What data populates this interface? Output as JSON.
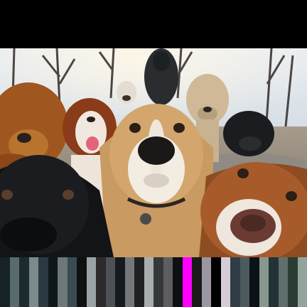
{
  "image": {
    "subject": "group-of-dogs-selfie",
    "colors": {
      "letterbox": "#000000",
      "sky": "#c9d7e6",
      "ground": "#9a8f7f",
      "trees": "#3a3230"
    }
  },
  "strip_colors": [
    "#152227",
    "#5a6b6e",
    "#1d2a2f",
    "#7b8a8c",
    "#2a3a40",
    "#0f171b",
    "#6c7879",
    "#3a4b52",
    "#101010",
    "#9aa3a4",
    "#2c2a2a",
    "#4d5354",
    "#141a1d",
    "#75777a",
    "#1f2224",
    "#a8aeb0",
    "#343839",
    "#5e5e60",
    "#0e0f12",
    "#ff00ff",
    "#1a1a1a",
    "#9a97a2",
    "#000000",
    "#d6ccd8",
    "#2f3e46",
    "#4c5a60",
    "#0b1318",
    "#87988e",
    "#233234",
    "#5f706c",
    "#2a3c33",
    "#91a59c"
  ]
}
